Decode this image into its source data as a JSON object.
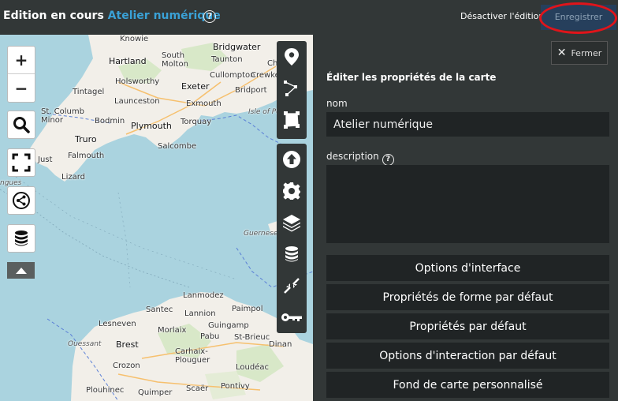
{
  "header": {
    "editing_label": "Edition en cours",
    "map_name": "Atelier numérique",
    "help_glyph": "?",
    "disable_edit_label": "Désactiver l'édition",
    "save_label": "Enregistrer"
  },
  "colors": {
    "topbar_bg": "#323737",
    "accent_blue": "#3aa1d6",
    "save_bg": "#263f5c",
    "highlight_ring": "#e0141a",
    "sea": "#aad3df",
    "land": "#f2efe9"
  },
  "map": {
    "zoom_in": "+",
    "zoom_out": "−",
    "places": {
      "knowle": "Knowie",
      "bridgwater": "Bridgwater",
      "hartland": "Hartland",
      "south_molton": "South\nMolton",
      "taunton": "Taunton",
      "chard": "Chard",
      "cullompton": "Cullompton",
      "crewkerne": "Crewkerne",
      "tintagel": "Tintagel",
      "holsworthy": "Holsworthy",
      "exeter": "Exeter",
      "bridport": "Bridport",
      "launceston": "Launceston",
      "exmouth": "Exmouth",
      "st_columb": "St. Columb\nMinor",
      "bodmin": "Bodmin",
      "plymouth": "Plymouth",
      "torquay": "Torquay",
      "isle_of_portland": "Isle of Portland",
      "truro": "Truro",
      "salcombe": "Salcombe",
      "just": "Just",
      "falmouth": "Falmouth",
      "lizard": "Lizard",
      "ingues": "ngues",
      "guernesey": "Guernesey",
      "lanmodez": "Lanmodez",
      "santec": "Santec",
      "lannion": "Lannion",
      "paimpol": "Paimpol",
      "lesneven": "Lesneven",
      "morlaix": "Morlaix",
      "guingamp": "Guingamp",
      "ouessant": "Ouessant",
      "pabu": "Pabu",
      "st_brieuc": "St-Brieuc",
      "brest": "Brest",
      "dinan": "Dinan",
      "carhaix": "Carhaix-\nPlouguer",
      "crozon": "Crozon",
      "loudeac": "Loudéac",
      "plouhinec": "Plouhinec",
      "quimper": "Quimper",
      "scaer": "Scaër",
      "pontivy": "Pontivy"
    }
  },
  "left_controls": [
    "zoom-in",
    "zoom-out",
    "search-icon",
    "fullscreen-icon",
    "share-icon",
    "database-icon",
    "collapse-arrow-icon"
  ],
  "toolbar": {
    "draw_tools": [
      "marker-icon",
      "polyline-icon",
      "polygon-icon"
    ],
    "edit_tools": [
      "upload-icon",
      "gear-icon",
      "layers-icon",
      "database-icon",
      "center-icon",
      "key-icon"
    ]
  },
  "panel": {
    "close_label": "Fermer",
    "heading": "Éditer les propriétés de la carte",
    "name_label": "nom",
    "name_value": "Atelier numérique",
    "description_label": "description",
    "description_value": "",
    "sections": [
      "Options d'interface",
      "Propriétés de forme par défaut",
      "Propriétés par défaut",
      "Options d'interaction par défaut",
      "Fond de carte personnalisé"
    ]
  }
}
